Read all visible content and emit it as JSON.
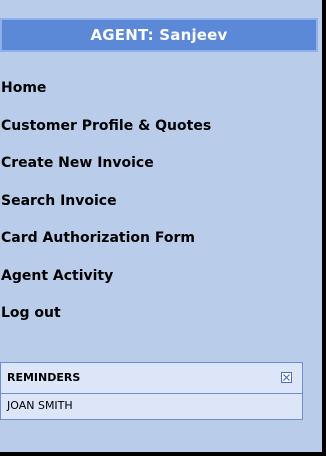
{
  "header": {
    "title": "AGENT: Sanjeev"
  },
  "nav": {
    "items": [
      {
        "label": "Home"
      },
      {
        "label": "Customer Profile & Quotes"
      },
      {
        "label": "Create New Invoice"
      },
      {
        "label": "Search Invoice"
      },
      {
        "label": "Card Authorization Form"
      },
      {
        "label": "Agent Activity"
      },
      {
        "label": "Log out"
      }
    ]
  },
  "reminders": {
    "title": "REMINDERS",
    "close_icon": "close-box-icon",
    "items": [
      {
        "name": "JOAN SMITH"
      }
    ]
  },
  "colors": {
    "panel_bg": "#b9cdea",
    "header_bg": "#5c88d8",
    "reminder_bg": "#dce6f8",
    "reminder_border": "#6b8fd0"
  }
}
